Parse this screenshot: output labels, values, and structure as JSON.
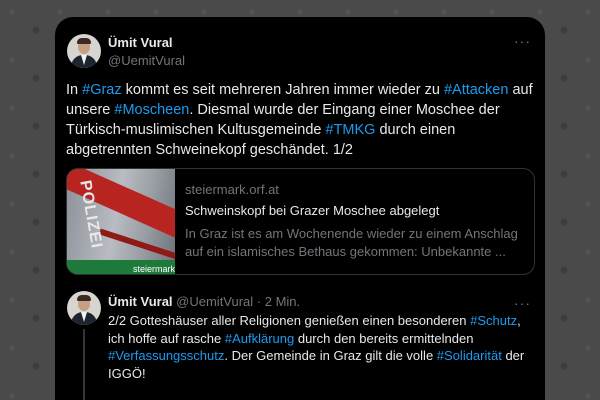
{
  "tweet": {
    "author_name": "Ümit Vural",
    "author_handle": "@UemitVural",
    "more_icon": "ellipsis-icon",
    "text": [
      {
        "t": "In "
      },
      {
        "t": "#Graz",
        "tag": true
      },
      {
        "t": " kommt es seit mehreren Jahren immer wieder zu "
      },
      {
        "t": "#Attacken",
        "tag": true
      },
      {
        "t": " auf unsere "
      },
      {
        "t": "#Moscheen",
        "tag": true
      },
      {
        "t": ". Diesmal wurde der Eingang einer Moschee der Türkisch-muslimischen Kultusgemeinde "
      },
      {
        "t": "#TMKG",
        "tag": true
      },
      {
        "t": " durch einen abgetrennten Schweinekopf geschändet. 1/2"
      }
    ]
  },
  "link_card": {
    "domain": "steiermark.orf.at",
    "title": "Schweinskopf bei Grazer Moschee abgelegt",
    "description": "In Graz ist es am Wochenende wieder zu einem Anschlag auf ein islamisches Bethaus gekommen: Unbekannte ...",
    "thumb_word": "POLIZEI",
    "thumb_label": "steiermark"
  },
  "reply": {
    "author_name": "Ümit Vural",
    "author_handle": "@UemitVural",
    "time": "· 2 Min.",
    "more_icon": "ellipsis-icon",
    "text": [
      {
        "t": "2/2 Gotteshäuser aller Religionen genießen einen besonderen "
      },
      {
        "t": "#Schutz",
        "tag": true
      },
      {
        "t": ", ich hoffe auf rasche "
      },
      {
        "t": "#Aufklärung",
        "tag": true
      },
      {
        "t": " durch den bereits ermittelnden "
      },
      {
        "t": "#Verfassungsschutz",
        "tag": true
      },
      {
        "t": ". Der Gemeinde in Graz gilt die volle "
      },
      {
        "t": "#Solidarität",
        "tag": true
      },
      {
        "t": " der IGGÖ!"
      }
    ]
  },
  "colors": {
    "background": "#000000",
    "text": "#e7e9ea",
    "muted": "#71767b",
    "hashtag": "#1d9bf0"
  }
}
